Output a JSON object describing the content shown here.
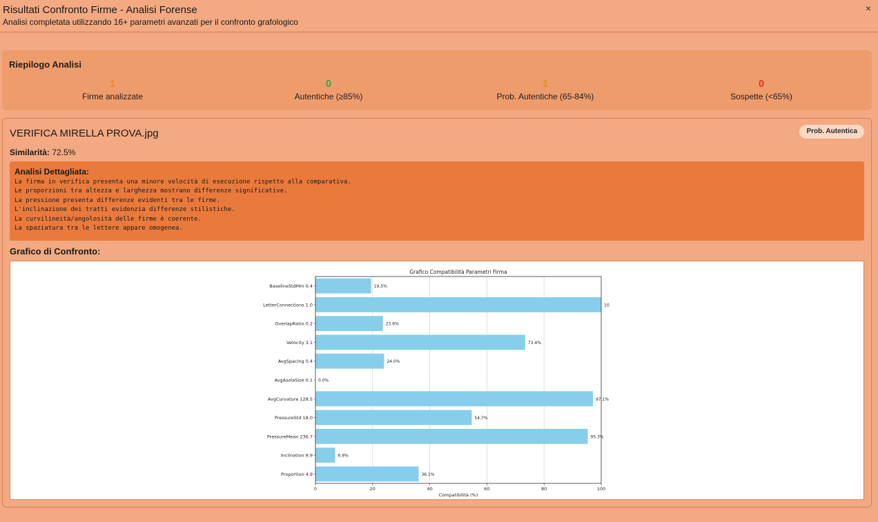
{
  "window": {
    "title": "Risultati Confronto Firme - Analisi Forense",
    "subtitle": "Analisi completata utilizzando 16+ parametri avanzati per il confronto grafologico",
    "close_glyph": "×"
  },
  "summary": {
    "title": "Riepilogo Analisi",
    "stats": [
      {
        "value": "1",
        "label": "Firme analizzate",
        "color": "#f28a22"
      },
      {
        "value": "0",
        "label": "Autentiche (≥85%)",
        "color": "#2fa84f"
      },
      {
        "value": "1",
        "label": "Prob. Autentiche (65-84%)",
        "color": "#e2960c"
      },
      {
        "value": "0",
        "label": "Sospette (<65%)",
        "color": "#e53528"
      }
    ]
  },
  "result": {
    "filename": "VERIFICA MIRELLA PROVA.jpg",
    "badge": "Prob. Autentica",
    "similarity_label": "Similarità:",
    "similarity_value": "72.5%",
    "detail_title": "Analisi Dettagliata:",
    "detail_lines": [
      "La firma in verifica presenta una minore velocità di esecuzione rispetto alla comparativa.",
      "Le proporzioni tra altezza e larghezza mostrano differenze significative.",
      "La pressione presenta differenze evidenti tra le firme.",
      "L'inclinazione dei tratti evidenzia differenze stilistiche.",
      "La curvilineità/angolosità delle firme è coerente.",
      "La spaziatura tra le lettere appare omogenea."
    ],
    "chart_section_title": "Grafico di Confronto:"
  },
  "chart_data": {
    "type": "bar",
    "orientation": "horizontal",
    "title": "Grafico Compatibilità Parametri Firma",
    "xlabel": "Compatibilità (%)",
    "ylabel": "",
    "xlim": [
      0,
      100
    ],
    "xticks": [
      0,
      20,
      40,
      60,
      80,
      100
    ],
    "grid": "vertical",
    "bar_color": "#87ceeb",
    "categories": [
      "BaselineStdMm 0.4",
      "LetterConnections 1.0",
      "OverlapRatio 0.2",
      "Velocity 3.1",
      "AvgSpacing 0.4",
      "AvgAsolaSize 0.1",
      "AvgCurvature 128.5",
      "PressureStd 18.0",
      "PressureMean 236.7",
      "Inclination 9.9",
      "Proportion 4.9"
    ],
    "values": [
      19.5,
      100.0,
      23.6,
      73.4,
      24.0,
      0.0,
      97.1,
      54.7,
      95.3,
      6.9,
      36.1
    ],
    "value_labels": [
      "19.5%",
      "10",
      "23.6%",
      "73.4%",
      "24.0%",
      "0.0%",
      "97.1%",
      "54.7%",
      "95.3%",
      "6.9%",
      "36.1%"
    ]
  }
}
